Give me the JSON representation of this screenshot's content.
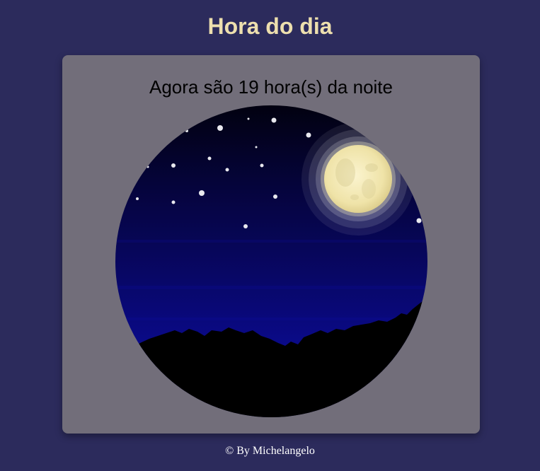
{
  "page": {
    "title": "Hora do dia",
    "message": "Agora são 19 hora(s) da noite",
    "footer": "© By Michelangelo"
  },
  "image": {
    "subject": "night-sky-with-moon",
    "icons": [
      "moon-icon",
      "star-icon",
      "treeline-silhouette"
    ]
  },
  "colors": {
    "background": "#2c2b5c",
    "title": "#eddfae",
    "card": "#726e7a",
    "sky_top": "#030217",
    "sky_bottom": "#0a0a8a",
    "moon": "#f2e8b5",
    "footer_text": "#ffffff"
  }
}
